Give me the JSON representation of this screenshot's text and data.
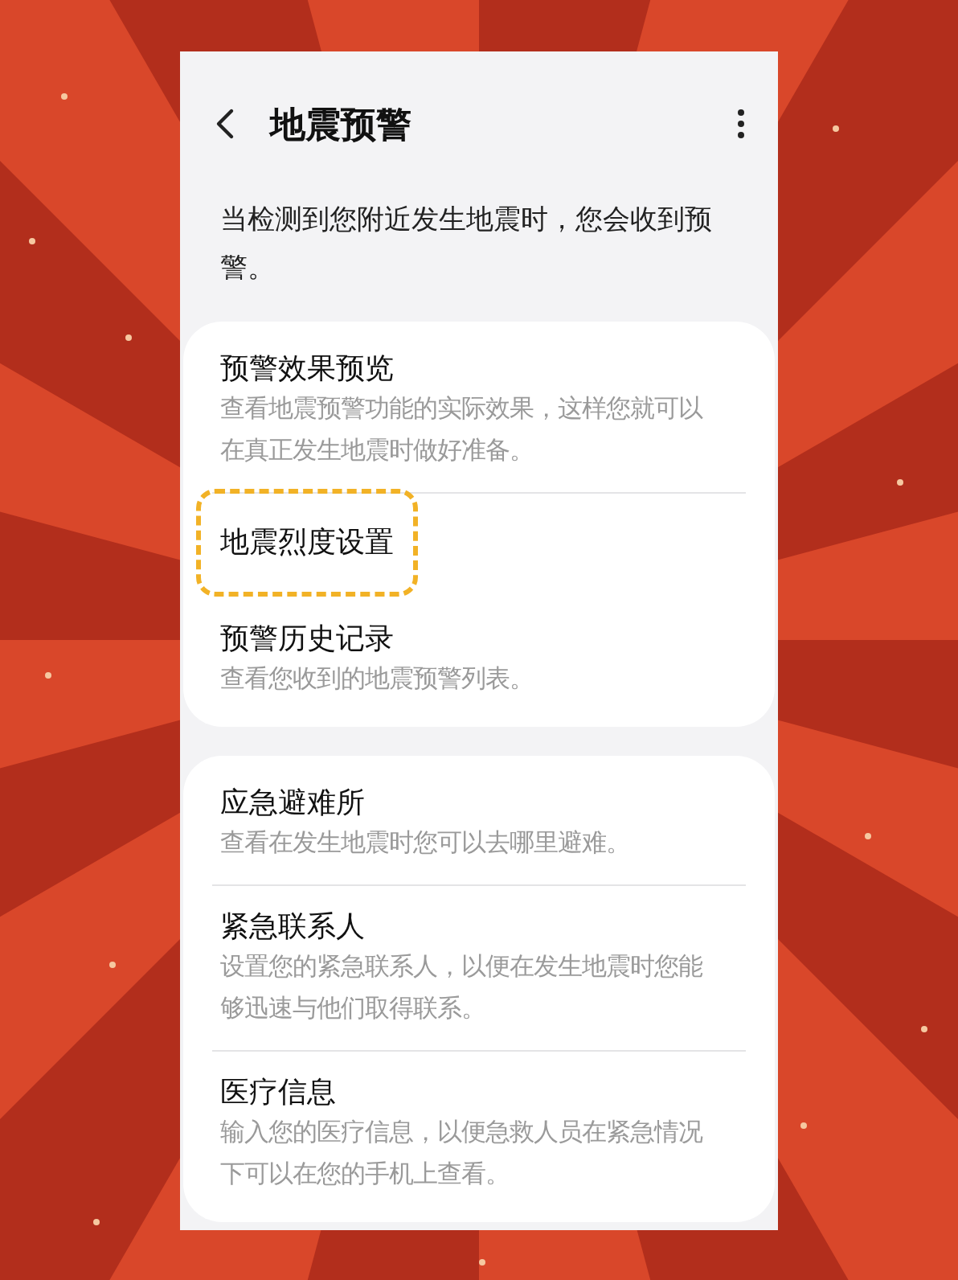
{
  "header": {
    "title": "地震预警"
  },
  "description": "当检测到您附近发生地震时，您会收到预警。",
  "sections": [
    {
      "items": [
        {
          "title": "预警效果预览",
          "subtitle": "查看地震预警功能的实际效果，这样您就可以在真正发生地震时做好准备。",
          "highlighted": false
        },
        {
          "title": "地震烈度设置",
          "highlighted": true
        },
        {
          "title": "预警历史记录",
          "subtitle": "查看您收到的地震预警列表。",
          "highlighted": false
        }
      ]
    },
    {
      "items": [
        {
          "title": "应急避难所",
          "subtitle": "查看在发生地震时您可以去哪里避难。",
          "highlighted": false
        },
        {
          "title": "紧急联系人",
          "subtitle": "设置您的紧急联系人，以便在发生地震时您能够迅速与他们取得联系。",
          "highlighted": false
        },
        {
          "title": "医疗信息",
          "subtitle": "输入您的医疗信息，以便急救人员在紧急情况下可以在您的手机上查看。",
          "highlighted": false
        }
      ]
    }
  ]
}
